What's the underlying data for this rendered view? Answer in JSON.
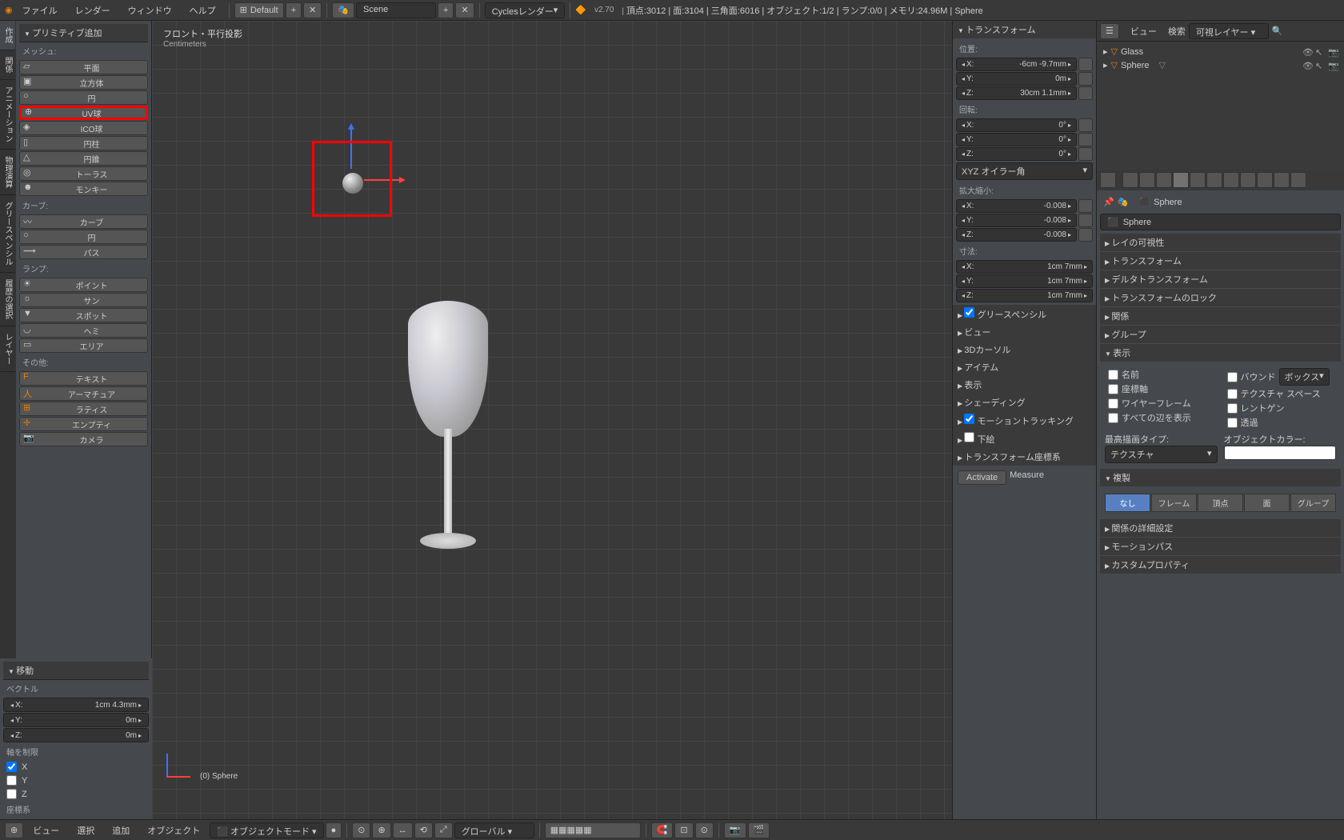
{
  "topbar": {
    "menus": [
      "ファイル",
      "レンダー",
      "ウィンドウ",
      "ヘルプ"
    ],
    "layout": "Default",
    "scene_label": "Scene",
    "engine": "Cyclesレンダー",
    "version_prefix": "v2.70",
    "stats": "頂点:3012 | 面:3104 | 三角面:6016 | オブジェクト:1/2 | ランプ:0/0 | メモリ:24.96M | Sphere"
  },
  "left_panel": {
    "title": "プリミティブ追加",
    "tabs": [
      "作成",
      "関係",
      "アニメーション",
      "物理演算",
      "グリースペンシル",
      "履歴の選択",
      "レイヤー"
    ],
    "mesh_label": "メッシュ:",
    "mesh_items": [
      "平面",
      "立方体",
      "円",
      "UV球",
      "ICO球",
      "円柱",
      "円錐",
      "トーラス",
      "モンキー"
    ],
    "curve_label": "カーブ:",
    "curve_items": [
      "カーブ",
      "円",
      "パス"
    ],
    "lamp_label": "ランプ:",
    "lamp_items": [
      "ポイント",
      "サン",
      "スポット",
      "ヘミ",
      "エリア"
    ],
    "other_label": "その他:",
    "other_items": [
      "テキスト",
      "アーマチュア",
      "ラティス",
      "エンプティ",
      "カメラ"
    ]
  },
  "left_bottom": {
    "title": "移動",
    "vector_label": "ベクトル",
    "vec": {
      "x": "1cm 4.3mm",
      "y": "0m",
      "z": "0m"
    },
    "constraint_label": "軸を制限",
    "axes": [
      "X",
      "Y",
      "Z"
    ],
    "coord_label": "座標系"
  },
  "viewport": {
    "title": "フロント・平行投影",
    "units": "Centimeters",
    "object_label": "(0) Sphere"
  },
  "n_panel": {
    "transform_title": "トランスフォーム",
    "location_label": "位置:",
    "location": {
      "x": "-6cm -9.7mm",
      "y": "0m",
      "z": "30cm 1.1mm"
    },
    "rotation_label": "回転:",
    "rotation": {
      "x": "0°",
      "y": "0°",
      "z": "0°"
    },
    "rotation_mode": "XYZ オイラー角",
    "scale_label": "拡大縮小:",
    "scale": {
      "x": "-0.008",
      "y": "-0.008",
      "z": "-0.008"
    },
    "dim_label": "寸法:",
    "dim": {
      "x": "1cm 7mm",
      "y": "1cm 7mm",
      "z": "1cm 7mm"
    },
    "sections": [
      "グリースペンシル",
      "ビュー",
      "3Dカーソル",
      "アイテム",
      "表示",
      "シェーディング",
      "モーショントラッキング",
      "下絵",
      "トランスフォーム座標系"
    ],
    "grease_checked": true,
    "motion_checked": true,
    "activate": "Activate",
    "measure": "Measure"
  },
  "outliner": {
    "header_view": "ビュー",
    "search_label": "検索",
    "layers": "可視レイヤー",
    "items": [
      {
        "name": "Glass",
        "indent": false
      },
      {
        "name": "Sphere",
        "indent": false
      }
    ]
  },
  "properties": {
    "breadcrumb_obj": "Sphere",
    "name": "Sphere",
    "sections_collapsed": [
      "レイの可視性",
      "トランスフォーム",
      "デルタトランスフォーム",
      "トランスフォームのロック",
      "関係",
      "グループ"
    ],
    "display_title": "表示",
    "display_checks_left": [
      "名前",
      "座標軸",
      "ワイヤーフレーム",
      "すべての辺を表示"
    ],
    "display_checks_right": [
      "バウンド",
      "テクスチャ スペース",
      "レントゲン",
      "透過"
    ],
    "bound_type": "ボックス",
    "max_draw_label": "最高描画タイプ:",
    "max_draw_value": "テクスチャ",
    "obj_color_label": "オブジェクトカラー:",
    "dup_title": "複製",
    "dup_options": [
      "なし",
      "フレーム",
      "頂点",
      "面",
      "グループ"
    ],
    "sections_bottom": [
      "関係の詳細設定",
      "モーションパス",
      "カスタムプロパティ"
    ]
  },
  "bottombar": {
    "items": [
      "ビュー",
      "選択",
      "追加",
      "オブジェクト"
    ],
    "mode": "オブジェクトモード",
    "orientation": "グローバル"
  }
}
